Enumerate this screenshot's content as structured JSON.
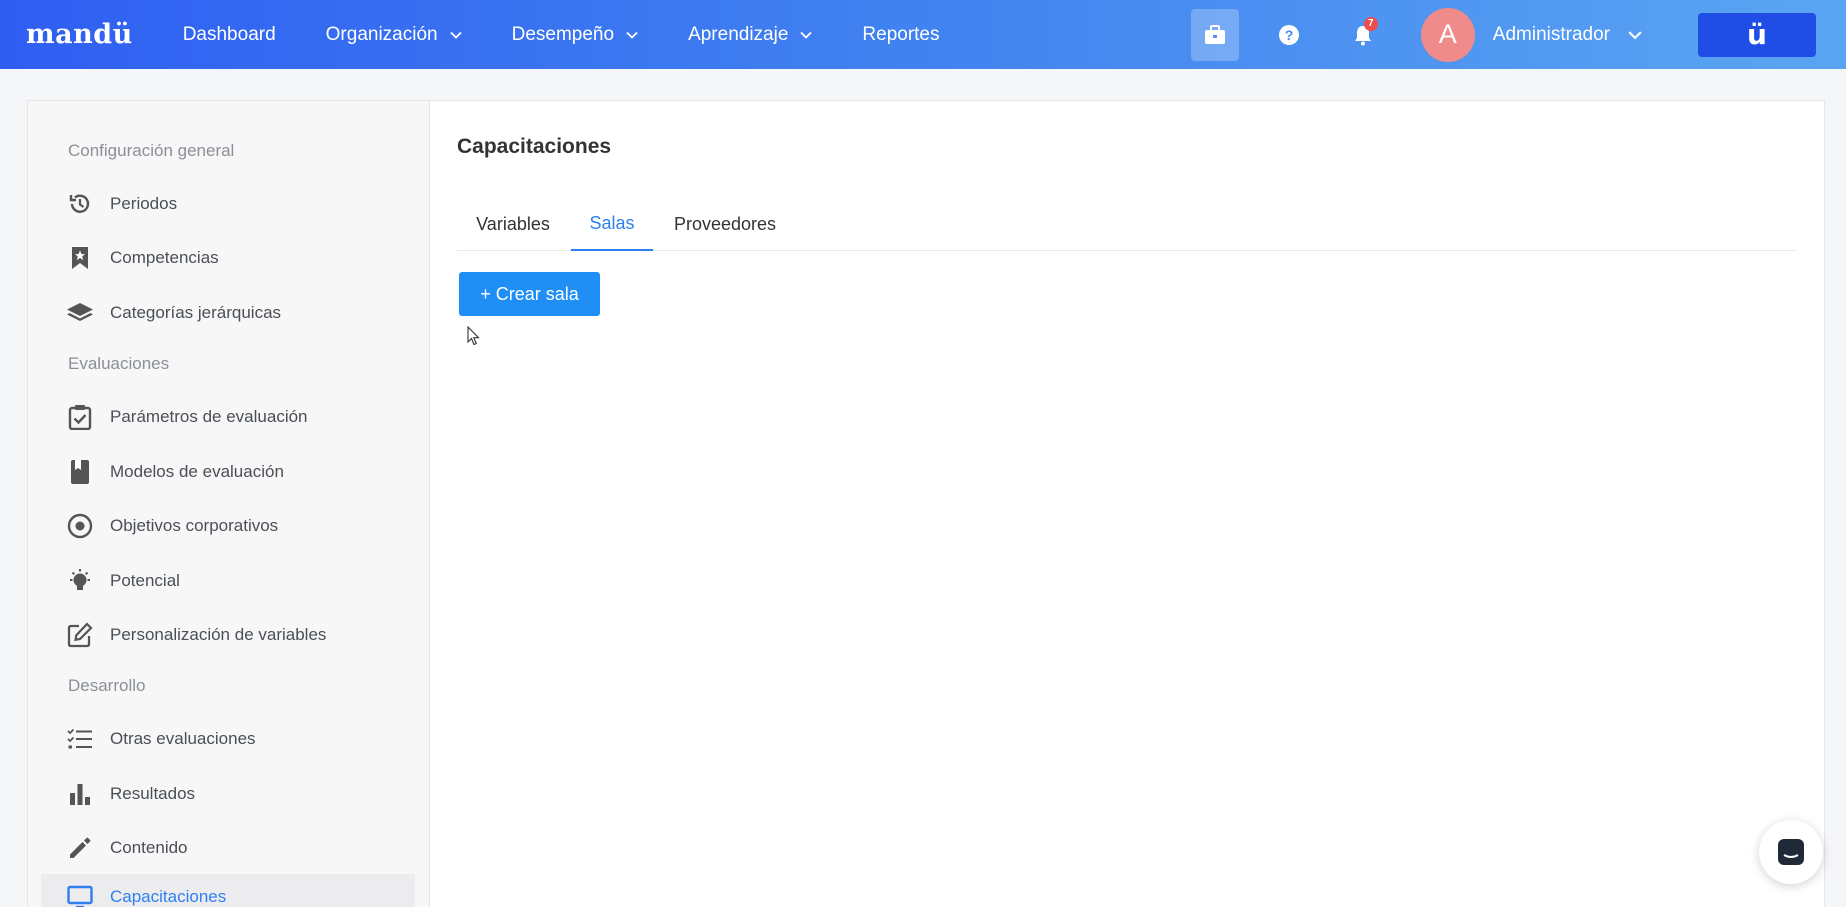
{
  "header": {
    "logo": "mandü",
    "nav": [
      {
        "label": "Dashboard",
        "has_dropdown": false
      },
      {
        "label": "Organización",
        "has_dropdown": true
      },
      {
        "label": "Desempeño",
        "has_dropdown": true
      },
      {
        "label": "Aprendizaje",
        "has_dropdown": true
      },
      {
        "label": "Reportes",
        "has_dropdown": false
      }
    ],
    "notification_count": "7",
    "avatar_initial": "A",
    "user_name": "Administrador",
    "brand_mark": "ü",
    "colors": {
      "gradient_start": "#2f5ef2",
      "gradient_end": "#5aa5f2",
      "brand_box": "#1f4de6",
      "badge": "#ef4b4b"
    }
  },
  "sidebar": {
    "sections": [
      {
        "title": "Configuración general",
        "items": [
          {
            "label": "Periodos",
            "icon": "history-icon"
          },
          {
            "label": "Competencias",
            "icon": "bookmark-star-icon"
          },
          {
            "label": "Categorías jerárquicas",
            "icon": "layers-icon"
          }
        ]
      },
      {
        "title": "Evaluaciones",
        "items": [
          {
            "label": "Parámetros de evaluación",
            "icon": "clipboard-check-icon"
          },
          {
            "label": "Modelos de evaluación",
            "icon": "book-icon"
          },
          {
            "label": "Objetivos corporativos",
            "icon": "target-icon"
          },
          {
            "label": "Potencial",
            "icon": "lightbulb-icon"
          },
          {
            "label": "Personalización de variables",
            "icon": "edit-square-icon"
          }
        ]
      },
      {
        "title": "Desarrollo",
        "items": [
          {
            "label": "Otras evaluaciones",
            "icon": "checklist-icon"
          },
          {
            "label": "Resultados",
            "icon": "bar-chart-icon"
          },
          {
            "label": "Contenido",
            "icon": "pencil-icon"
          },
          {
            "label": "Capacitaciones",
            "icon": "monitor-icon",
            "active": true
          }
        ]
      }
    ]
  },
  "main": {
    "title": "Capacitaciones",
    "tabs": [
      {
        "label": "Variables",
        "active": false
      },
      {
        "label": "Salas",
        "active": true
      },
      {
        "label": "Proveedores",
        "active": false
      }
    ],
    "create_button": "+ Crear sala",
    "accent_color": "#2f7ff0"
  }
}
